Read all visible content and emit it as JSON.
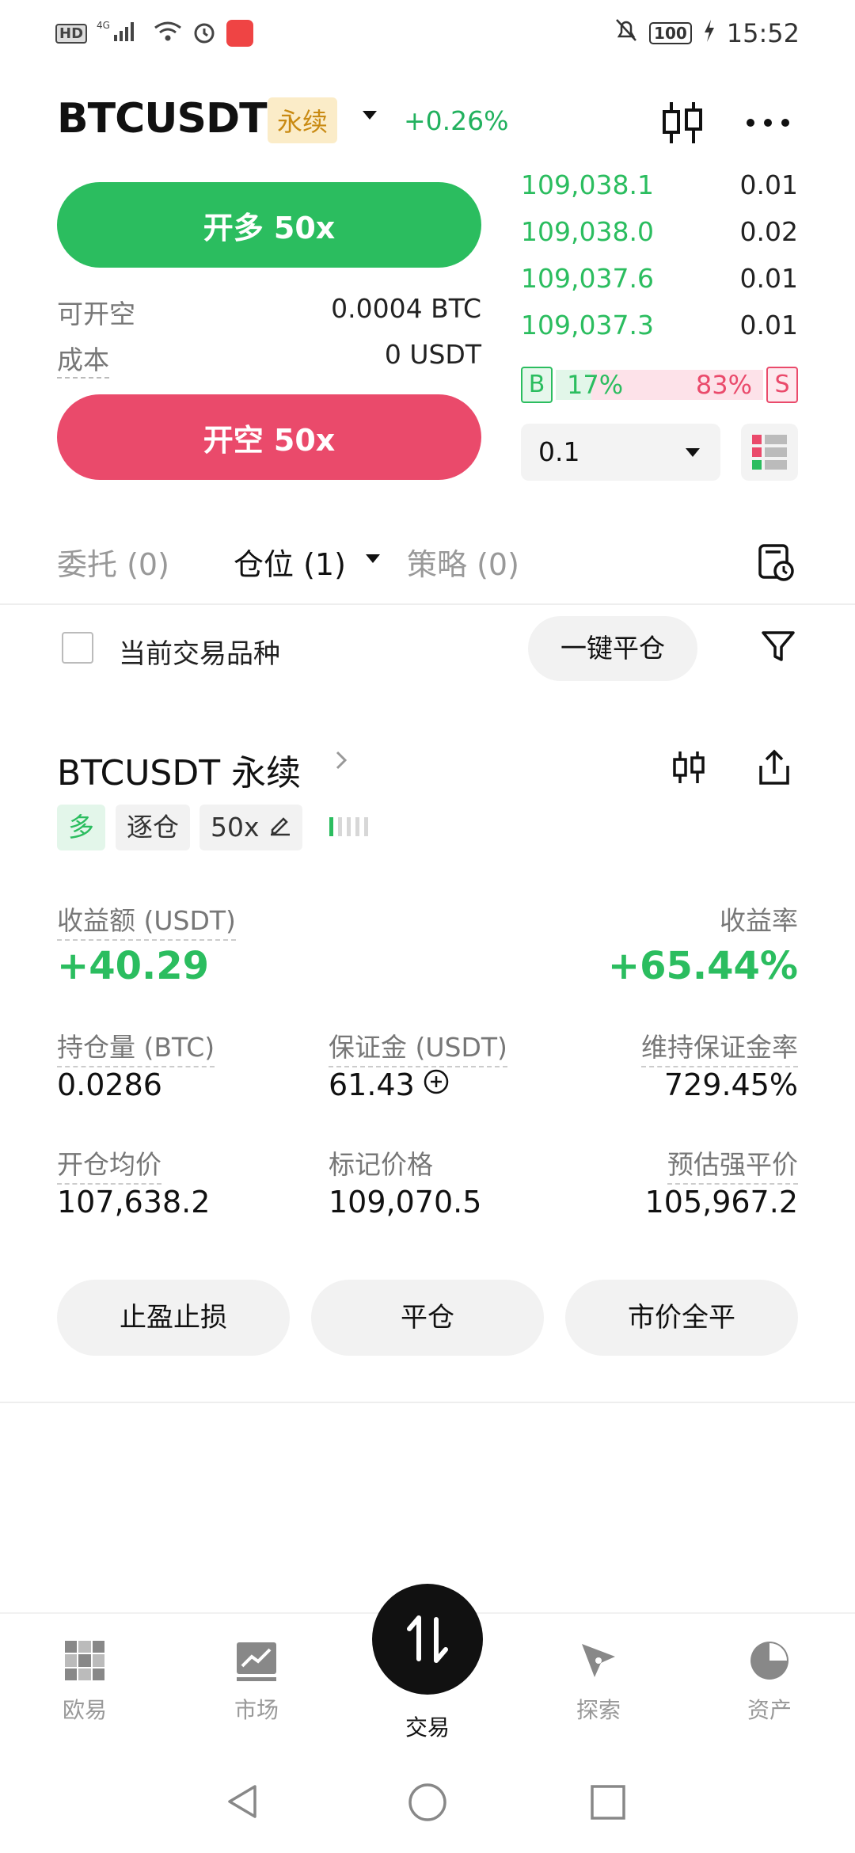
{
  "status_bar": {
    "hd": "HD",
    "network": "4G",
    "battery": "100",
    "time": "15:52"
  },
  "header": {
    "pair": "BTCUSDT",
    "contract_type": "永续",
    "change": "+0.26%"
  },
  "trade_panel": {
    "long_button": "开多 50x",
    "short_button": "开空 50x",
    "available_label": "可开空",
    "available_value": "0.0004 BTC",
    "cost_label": "成本",
    "cost_value": "0 USDT"
  },
  "order_book": {
    "rows": [
      {
        "price": "109,038.1",
        "qty": "0.01"
      },
      {
        "price": "109,038.0",
        "qty": "0.02"
      },
      {
        "price": "109,037.6",
        "qty": "0.01"
      },
      {
        "price": "109,037.3",
        "qty": "0.01"
      }
    ],
    "buy_label": "B",
    "sell_label": "S",
    "buy_pct": "17%",
    "sell_pct": "83%",
    "buy_ratio": 0.17,
    "depth_select": "0.1"
  },
  "tabs": {
    "orders": "委托 (0)",
    "positions": "仓位 (1)",
    "strategies": "策略 (0)"
  },
  "filter": {
    "current_pair_label": "当前交易品种",
    "close_all": "一键平仓"
  },
  "position": {
    "title": "BTCUSDT 永续",
    "side": "多",
    "margin_mode": "逐仓",
    "leverage": "50x",
    "leverage_level": 0.2,
    "pnl_label": "收益额 (USDT)",
    "pnl_value": "+40.29",
    "roe_label": "收益率",
    "roe_value": "+65.44%",
    "size_label": "持仓量 (BTC)",
    "size_value": "0.0286",
    "margin_label": "保证金 (USDT)",
    "margin_value": "61.43",
    "mmr_label": "维持保证金率",
    "mmr_value": "729.45%",
    "entry_label": "开仓均价",
    "entry_value": "107,638.2",
    "mark_label": "标记价格",
    "mark_value": "109,070.5",
    "liq_label": "预估强平价",
    "liq_value": "105,967.2",
    "tpsl_button": "止盈止损",
    "close_button": "平仓",
    "market_close_button": "市价全平"
  },
  "bottom_nav": {
    "home": "欧易",
    "market": "市场",
    "trade": "交易",
    "explore": "探索",
    "assets": "资产"
  },
  "colors": {
    "green": "#2bbd5f",
    "red": "#ea4a6b",
    "badge_bg": "#fbecc8",
    "badge_text": "#c98a12"
  }
}
